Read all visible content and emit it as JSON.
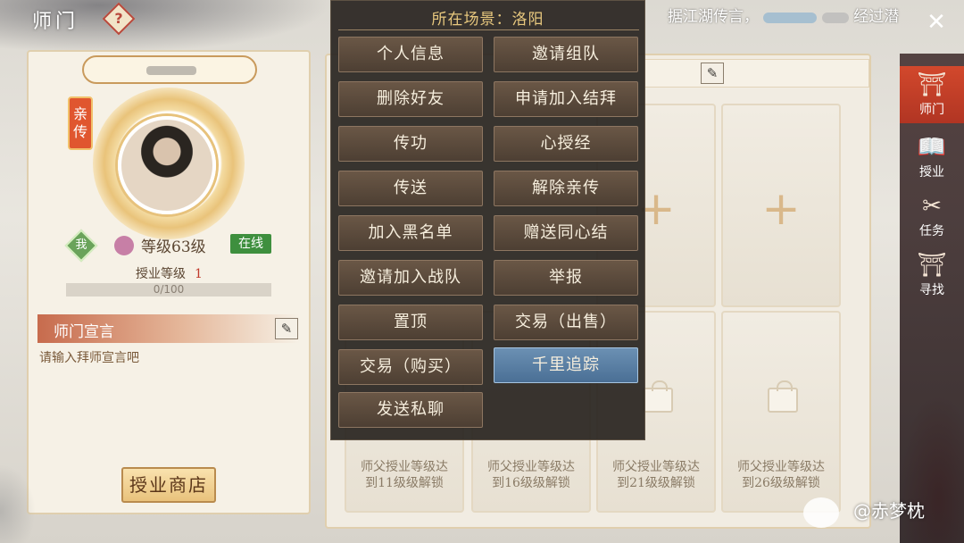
{
  "header": {
    "title": "师门",
    "help_icon": "question-icon"
  },
  "rumor": {
    "prefix": "据江湖传言，",
    "suffix": "经过潜"
  },
  "profile": {
    "tag": "亲传",
    "me_label": "我",
    "level": "等级63级",
    "status": "在线",
    "teach_level_label": "授业等级",
    "teach_level_value": "1",
    "progress_text": "0/100",
    "progress_fraction": 0
  },
  "declaration": {
    "title": "师门宣言",
    "placeholder": "请输入拜师宣言吧"
  },
  "shop_button": "授业商店",
  "popup": {
    "title": "所在场景：洛阳",
    "buttons": [
      "个人信息",
      "邀请组队",
      "删除好友",
      "申请加入结拜",
      "传功",
      "心授经",
      "传送",
      "解除亲传",
      "加入黑名单",
      "赠送同心结",
      "邀请加入战队",
      "举报",
      "置顶",
      "交易（出售）",
      "交易（购买）",
      "千里追踪",
      "发送私聊"
    ],
    "active_button": "千里追踪"
  },
  "slots": {
    "unlock_texts": [
      [
        "师父授业等级达",
        "到11级级解锁"
      ],
      [
        "师父授业等级达",
        "到16级级解锁"
      ],
      [
        "师父授业等级达",
        "到21级级解锁"
      ],
      [
        "师父授业等级达",
        "到26级级解锁"
      ]
    ]
  },
  "nav": {
    "items": [
      {
        "label": "师门",
        "icon": "gate-icon"
      },
      {
        "label": "授业",
        "icon": "book-icon"
      },
      {
        "label": "任务",
        "icon": "scroll-icon"
      },
      {
        "label": "寻找",
        "icon": "search-gate-icon"
      }
    ]
  },
  "watermark": "@赤梦枕",
  "colors": {
    "accent": "#e8c87e",
    "active_nav": "#d2482c",
    "active_menu": "#5a80a6",
    "online": "#3e8f3e"
  }
}
